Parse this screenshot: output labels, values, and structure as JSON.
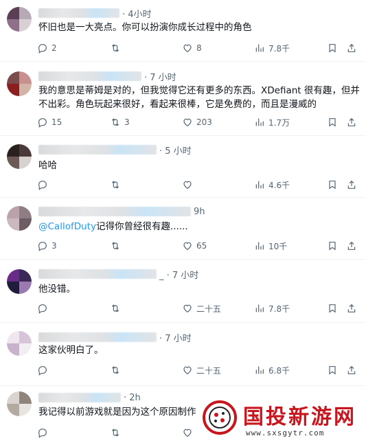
{
  "tweets": [
    {
      "time": "· 4小时",
      "text": "怀旧也是一大亮点。你可以扮演你成长过程中的角色",
      "mention": "",
      "reply_count": "2",
      "retweet_count": "",
      "like_count": "8",
      "view_count": "7.8千"
    },
    {
      "time": "· 7 小时",
      "text": "我的意思是蒂姆是对的，但我觉得它还有更多的东西。XDefiant 很有趣，但并不出彩。角色玩起来很好，看起来很棒，它是免费的，而且是漫威的",
      "mention": "",
      "reply_count": "15",
      "retweet_count": "3",
      "like_count": "203",
      "view_count": "1.7万"
    },
    {
      "time": "· 5 小时",
      "text": "哈哈",
      "mention": "",
      "reply_count": "",
      "retweet_count": "",
      "like_count": "",
      "view_count": "4.6千"
    },
    {
      "time": "9h",
      "text": "记得你曾经很有趣......",
      "mention": "@CallofDuty",
      "reply_count": "3",
      "retweet_count": "",
      "like_count": "65",
      "view_count": "10千"
    },
    {
      "time": "_ · 7 小时",
      "text": "他没错。",
      "mention": "",
      "reply_count": "",
      "retweet_count": "",
      "like_count": "二十五",
      "view_count": "7.8千"
    },
    {
      "time": "· 7 小时",
      "text": "这家伙明白了。",
      "mention": "",
      "reply_count": "",
      "retweet_count": "",
      "like_count": "二十五",
      "view_count": "6.8千"
    },
    {
      "time": "· 2h",
      "text": "我记得以前游戏就是因为这个原因制作",
      "mention": "",
      "reply_count": "",
      "retweet_count": "",
      "like_count": "",
      "view_count": ""
    }
  ],
  "colors": {
    "text": "#0f1419",
    "meta": "#536471",
    "link": "#1d9bf0",
    "divider": "#eff3f4",
    "watermark_red": "#c7161e"
  },
  "icons": [
    "reply-icon",
    "retweet-icon",
    "like-icon",
    "views-icon",
    "bookmark-icon",
    "share-icon"
  ],
  "watermark": {
    "title": "国投新游网",
    "url": "www.sxsgytr.com"
  }
}
